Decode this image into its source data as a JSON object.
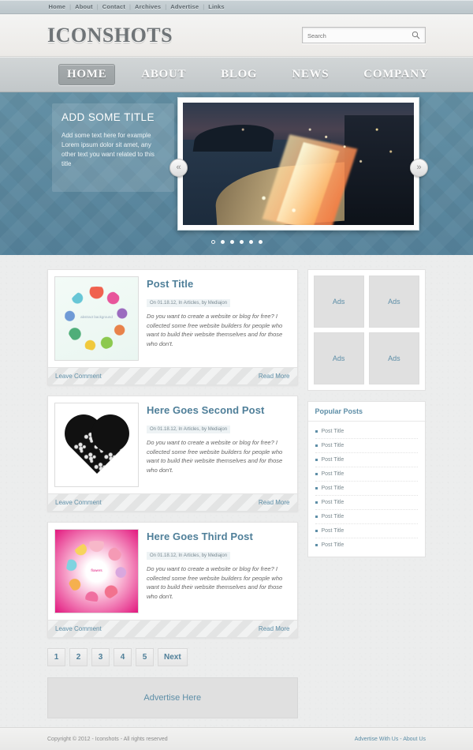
{
  "topbar": {
    "links": [
      "Home",
      "About",
      "Contact",
      "Archives",
      "Advertise",
      "Links"
    ],
    "separator": "|"
  },
  "header": {
    "logo": "ICONSHOTS",
    "search": {
      "placeholder": "Search",
      "value": "",
      "icon": "search-icon"
    }
  },
  "nav": {
    "items": [
      {
        "label": "HOME",
        "active": true
      },
      {
        "label": "ABOUT",
        "active": false
      },
      {
        "label": "BLOG",
        "active": false
      },
      {
        "label": "NEWS",
        "active": false
      },
      {
        "label": "COMPANY",
        "active": false
      }
    ]
  },
  "slider": {
    "caption_title": "ADD SOME TITLE",
    "caption_text": "Add some text here for example Lorem ipsum dolor sit amet, any other text you want related to this title",
    "prev_icon": "«",
    "next_icon": "»",
    "dots_total": 6,
    "dot_active_index": 0,
    "image_alt": "night city beach coastline with traffic light trails"
  },
  "posts": [
    {
      "title": "Post Title",
      "meta": "On 01.18.12, In Articles, by Mediajon",
      "text": "Do you want to create a website or blog for free? I collected some free website builders for people who want to build their website themselves and for those who don't.",
      "thumb_label": "abstract background",
      "comment_label": "Leave Comment",
      "readmore_label": "Read More"
    },
    {
      "title": "Here Goes Second Post",
      "meta": "On 01.18.12, In Articles, by Mediajon",
      "text": "Do you want to create a website or blog for free? I collected some free website builders for people who want to build their website themselves and for those who don't.",
      "thumb_label": "",
      "comment_label": "Leave Comment",
      "readmore_label": "Read More"
    },
    {
      "title": "Here Goes Third Post",
      "meta": "On 01.18.12, In Articles, by Mediajon",
      "text": "Do you want to create a website or blog for free? I collected some free website builders for people who want to build their website themselves and for those who don't.",
      "thumb_label": "flowers",
      "comment_label": "Leave Comment",
      "readmore_label": "Read More"
    }
  ],
  "pagination": {
    "pages": [
      "1",
      "2",
      "3",
      "4",
      "5"
    ],
    "next_label": "Next",
    "current": "1"
  },
  "advertise_banner": {
    "label": "Advertise Here"
  },
  "sidebar": {
    "ads": [
      "Ads",
      "Ads",
      "Ads",
      "Ads"
    ],
    "popular": {
      "title": "Popular Posts",
      "items": [
        "Post Title",
        "Post Title",
        "Post Title",
        "Post Title",
        "Post Title",
        "Post Title",
        "Post Title",
        "Post Title",
        "Post Title"
      ]
    }
  },
  "footer": {
    "copyright": "Copyright © 2012 - Iconshots - All rights reserved",
    "links": [
      "Advertise With Us",
      "About Us"
    ],
    "link_separator": "-"
  },
  "colors": {
    "accent": "#5d8ea7",
    "slider_bg": "#5d8ea7",
    "nav_bg": "#c8cdcf",
    "page_bg": "#eceded"
  }
}
